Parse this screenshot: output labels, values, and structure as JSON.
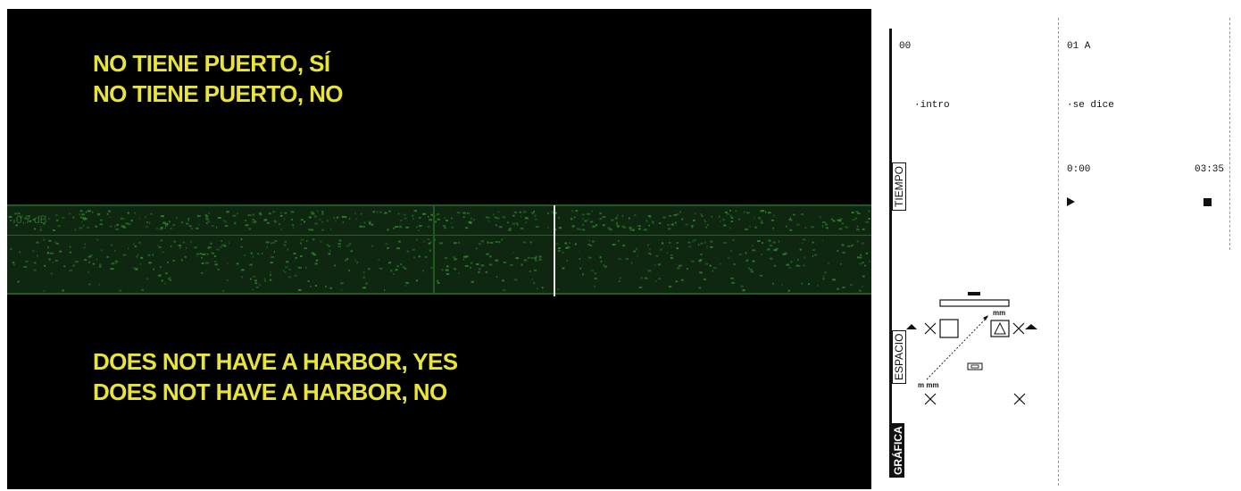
{
  "video": {
    "subtitle_spanish": [
      "NO TIENE PUERTO, SÍ",
      "NO TIENE PUERTO, NO"
    ],
    "subtitle_english": [
      "DOES NOT HAVE A HARBOR, YES",
      "DOES NOT HAVE A HARBOR, NO"
    ],
    "waveform": {
      "level_label": "-0,7 dB",
      "colors": {
        "background": "#0f2710",
        "border": "#1f5a1f",
        "signal": "#2f8a2f",
        "playhead": "#e8e8e8"
      }
    },
    "subtitle_color": "#e9e43a"
  },
  "score": {
    "axis_labels": {
      "tiempo": "TIEMPO",
      "espacio": "ESPACIO",
      "grafica": "GRÁFICA"
    },
    "columns": [
      {
        "title": "00",
        "section": "·intro"
      },
      {
        "title": "01 A",
        "section": "·se dice"
      }
    ],
    "transport": {
      "time_start": "0:00",
      "time_end": "03:35",
      "play_icon": "play-icon",
      "stop_icon": "stop-icon"
    },
    "diagram": {
      "label_top_right": "mm",
      "label_bottom_left": "m mm",
      "icons": [
        "stage-bar-icon",
        "speaker-icon",
        "warning-icon",
        "cross-icon",
        "triangle-up-icon",
        "small-box-icon"
      ]
    }
  }
}
